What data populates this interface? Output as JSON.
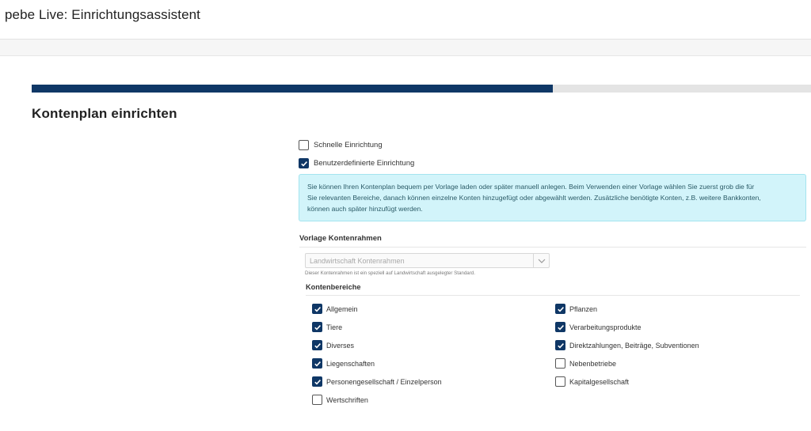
{
  "header": {
    "title": "pebe Live: Einrichtungsassistent"
  },
  "wizard": {
    "progress": 0.669
  },
  "step": {
    "title": "Kontenplan einrichten",
    "modes": [
      {
        "label": "Schnelle Einrichtung",
        "checked": false
      },
      {
        "label": "Benutzerdefinierte Einrichtung",
        "checked": true
      }
    ],
    "info_lines": [
      "Sie können Ihren Kontenplan bequem per Vorlage laden oder später manuell anlegen. Beim Verwenden einer Vorlage wählen Sie zuerst grob die für",
      "Sie relevanten Bereiche, danach können einzelne Konten hinzugefügt oder abgewählt werden. Zusätzliche benötigte Konten, z.B. weitere Bankkonten,",
      "können auch später hinzufügt werden."
    ]
  },
  "template": {
    "label": "Vorlage Kontenrahmen",
    "selected": "Landwirtschaft Kontenrahmen",
    "help": "Dieser Kontenrahmen ist ein speziell auf Landwirtschaft ausgelegter Standard."
  },
  "areas": {
    "label": "Kontenbereiche",
    "left": [
      {
        "label": "Allgemein",
        "checked": true
      },
      {
        "label": "Tiere",
        "checked": true
      },
      {
        "label": "Diverses",
        "checked": true
      },
      {
        "label": "Liegenschaften",
        "checked": true
      },
      {
        "label": "Personengesellschaft / Einzelperson",
        "checked": true
      },
      {
        "label": "Wertschriften",
        "checked": false
      }
    ],
    "right": [
      {
        "label": "Pflanzen",
        "checked": true
      },
      {
        "label": "Verarbeitungsprodukte",
        "checked": true
      },
      {
        "label": "Direktzahlungen, Beiträge, Subventionen",
        "checked": true
      },
      {
        "label": "Nebenbetriebe",
        "checked": false
      },
      {
        "label": "Kapitalgesellschaft",
        "checked": false
      }
    ]
  },
  "colors": {
    "accent": "#0f3766",
    "info_bg": "#d2f4fa"
  }
}
